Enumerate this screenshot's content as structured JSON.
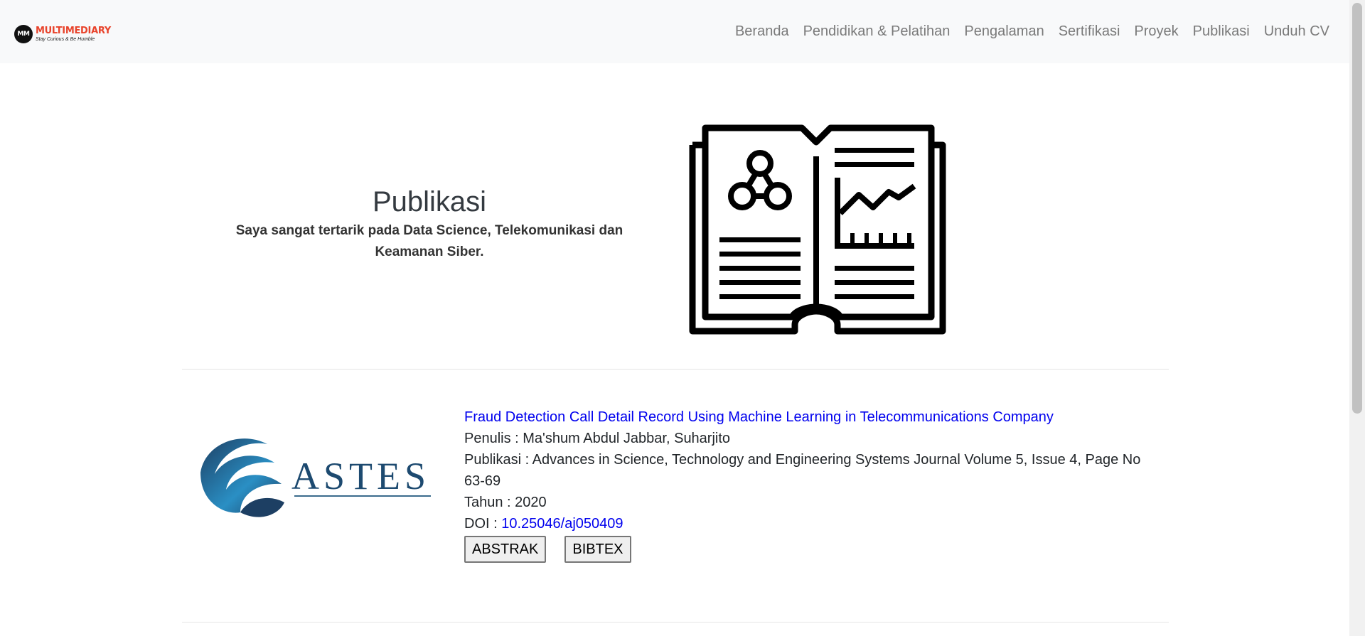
{
  "brand": {
    "mark": "MM",
    "name": "MULTIMEDIARY",
    "tagline": "Stay Curious & Be Humble"
  },
  "nav": {
    "items": [
      "Beranda",
      "Pendidikan & Pelatihan",
      "Pengalaman",
      "Sertifikasi",
      "Proyek",
      "Publikasi",
      "Unduh CV"
    ]
  },
  "hero": {
    "title": "Publikasi",
    "subtitle": "Saya sangat tertarik pada Data Science, Telekomunikasi dan Keamanan Siber.",
    "icon": "open-book-data-icon"
  },
  "publication": {
    "logo_text": "ASTES",
    "title": "Fraud Detection Call Detail Record Using Machine Learning in Telecommunications Company",
    "authors_label": "Penulis : ",
    "authors": "Ma'shum Abdul Jabbar, Suharjito",
    "publisher_label": "Publikasi : ",
    "publisher": "Advances in Science, Technology and Engineering Systems Journal Volume 5, Issue 4, Page No 63-69",
    "year_label": "Tahun : ",
    "year": "2020",
    "doi_label": "DOI : ",
    "doi": "10.25046/aj050409",
    "abstract_button": "ABSTRAK",
    "bibtex_button": "BIBTEX"
  },
  "colors": {
    "navbar_bg": "#f8f9fa",
    "brand_accent": "#e8432b",
    "link": "#0000ee"
  }
}
